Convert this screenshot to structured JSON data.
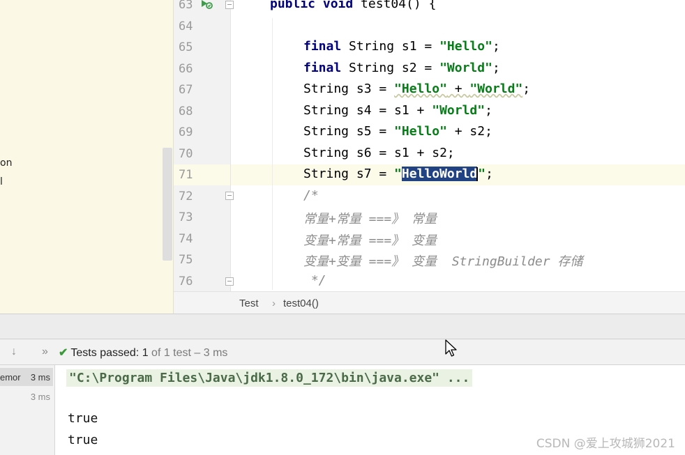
{
  "left_panel": {
    "fragments": [
      "on",
      "l"
    ]
  },
  "editor": {
    "line_numbers": [
      "63",
      "64",
      "65",
      "66",
      "67",
      "68",
      "69",
      "70",
      "71",
      "72",
      "73",
      "74",
      "75",
      "76"
    ],
    "method_line": {
      "kw": "public void",
      "rest": " test04() {"
    },
    "lines": {
      "l65": {
        "kw": "final",
        "a": " String s1 = ",
        "s1": "\"Hello\"",
        "end": ";"
      },
      "l66": {
        "kw": "final",
        "a": " String s2 = ",
        "s1": "\"World\"",
        "end": ";"
      },
      "l67": {
        "a": "String s3 = ",
        "s1": "\"Hello\"",
        "b": " + ",
        "s2": "\"World\"",
        "end": ";"
      },
      "l68": {
        "a": "String s4 = s1 + ",
        "s1": "\"World\"",
        "end": ";"
      },
      "l69": {
        "a": "String s5 = ",
        "s1": "\"Hello\"",
        "end": " + s2;"
      },
      "l70": {
        "a": "String s6 = s1 + s2;"
      },
      "l71": {
        "a": "String s7 = ",
        "q1": "\"",
        "sel": "HelloWorld",
        "q2": "\"",
        "end": ";"
      },
      "l72": "/*",
      "l73": "常量+常量 ===》 常量",
      "l74": "变量+常量 ===》 变量",
      "l75": "变量+变量 ===》 变量  StringBuilder 存储",
      "l76": " */"
    }
  },
  "breadcrumb": {
    "class": "Test",
    "separator": "›",
    "method": "test04()"
  },
  "run_toolbar": {
    "down_arrow": "↓",
    "more": "»",
    "status_label": "Tests passed: ",
    "passed": "1",
    "of_text": " of 1 test",
    "duration": " – 3 ms"
  },
  "test_tree": [
    {
      "name": "emor",
      "time": "3 ms"
    },
    {
      "name": "",
      "time": "3 ms"
    }
  ],
  "console": {
    "command": "\"C:\\Program Files\\Java\\jdk1.8.0_172\\bin\\java.exe\" ...",
    "output": [
      "true",
      "true"
    ]
  },
  "watermark": "CSDN @爱上攻城狮2021",
  "colors": {
    "keyword": "#000080",
    "string": "#067d17",
    "comment": "#8c8c8c",
    "selection": "#214283",
    "pass": "#3a9a3a"
  },
  "icons": [
    "run-test-icon",
    "fold-icon",
    "check-icon",
    "mouse-cursor-icon"
  ]
}
